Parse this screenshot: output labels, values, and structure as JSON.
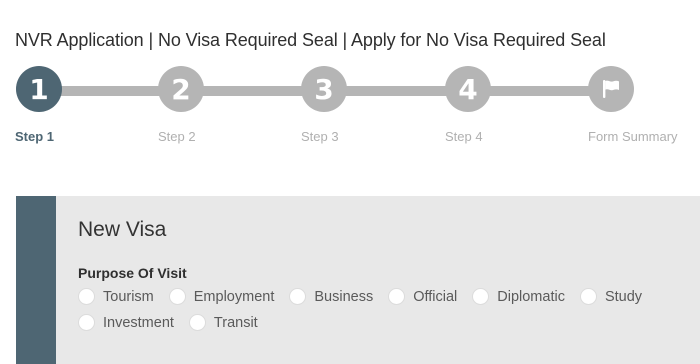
{
  "page": {
    "title": "NVR Application | No Visa Required Seal | Apply for No Visa Required Seal"
  },
  "stepper": {
    "steps": [
      {
        "number": "1",
        "label": "Step 1",
        "active": true
      },
      {
        "number": "2",
        "label": "Step 2",
        "active": false
      },
      {
        "number": "3",
        "label": "Step 3",
        "active": false
      },
      {
        "number": "4",
        "label": "Step 4",
        "active": false
      },
      {
        "icon": "flag-icon",
        "label": "Form Summary",
        "active": false
      }
    ]
  },
  "form": {
    "section_title": "New Visa",
    "purpose_label": "Purpose Of Visit",
    "purpose_options": [
      "Tourism",
      "Employment",
      "Business",
      "Official",
      "Diplomatic",
      "Study",
      "Investment",
      "Transit"
    ]
  },
  "colors": {
    "active_step": "#4e6673",
    "inactive_step": "#b5b5b5",
    "panel_background": "#e8e8e8"
  }
}
